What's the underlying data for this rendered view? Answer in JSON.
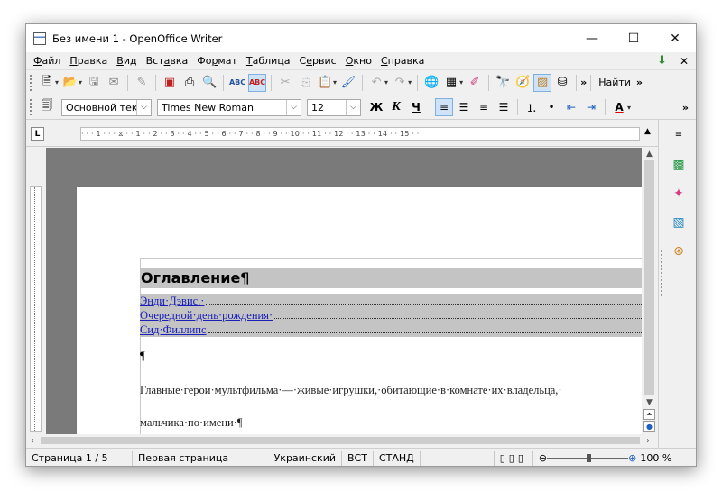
{
  "window": {
    "title": "Без имени 1 - OpenOffice Writer"
  },
  "menu": {
    "items": [
      {
        "u": "Ф",
        "rest": "айл"
      },
      {
        "u": "П",
        "rest": "равка"
      },
      {
        "u": "В",
        "rest": "ид"
      },
      {
        "pre": "Вст",
        "u": "а",
        "rest": "вка"
      },
      {
        "pre": "Фо",
        "u": "р",
        "rest": "мат"
      },
      {
        "u": "Т",
        "rest": "аблица"
      },
      {
        "pre": "С",
        "u": "е",
        "rest": "рвис"
      },
      {
        "u": "О",
        "rest": "кно"
      },
      {
        "u": "С",
        "rest": "правка"
      }
    ]
  },
  "toolbar2": {
    "style": "Основной текст",
    "font": "Times New Roman",
    "size": "12",
    "bold": "Ж",
    "italic": "К",
    "underline": "Ч"
  },
  "toolbar1": {
    "find": "Найти"
  },
  "ruler": {
    "ticks": "· · · 1 · · · ⧖ · · 1 · · 2 · · 3 · · 4 · · 5 · · 6 · · 7 · · 8 · · 9 · · 10 · · 11 · · 12 · · 13 · · 14 · · 15 · · "
  },
  "document": {
    "toc_heading": "Оглавление¶",
    "toc_entries": [
      "Энди·Дэвис.·",
      "Очередной·день·рождения·",
      "Сид·Филлипс"
    ],
    "para_mark": "¶",
    "line1": "Главные·герои·мультфильма·—·живые·игрушки,·обитающие·в·комнате·их·владельца,·",
    "line2": "мальчика·по·имени·¶"
  },
  "status": {
    "page": "Страница  1 / 5",
    "page_style": "Первая страница",
    "language": "Украинский",
    "insert": "ВСТ",
    "select": "СТАНД",
    "zoom": "100 %"
  }
}
